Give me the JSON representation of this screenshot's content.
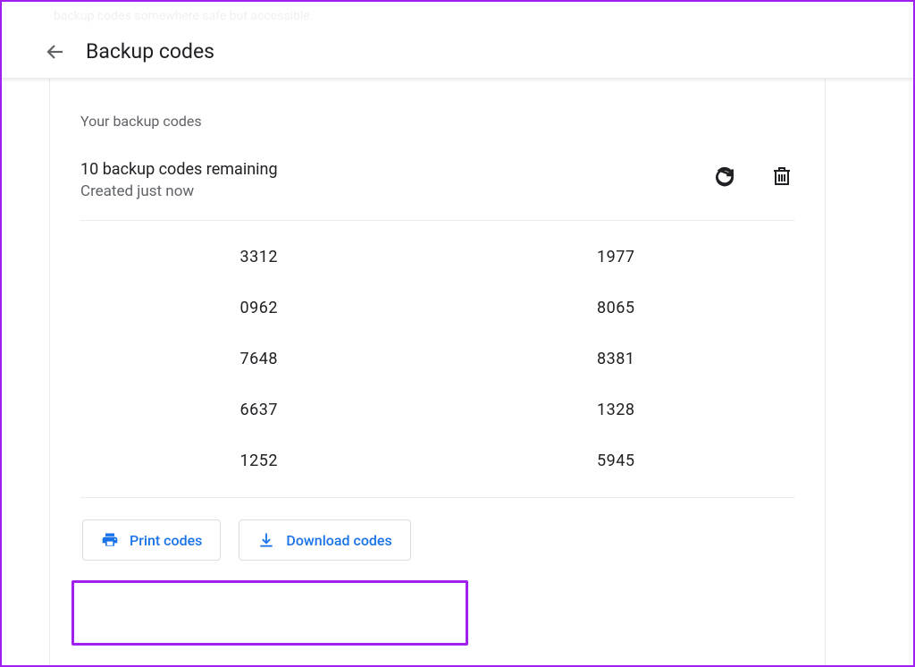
{
  "header": {
    "title": "Backup codes"
  },
  "section": {
    "label": "Your backup codes",
    "remaining": "10 backup codes remaining",
    "created": "Created just now"
  },
  "codes": {
    "col1": [
      "3312",
      "0962",
      "7648",
      "6637",
      "1252"
    ],
    "col2": [
      "1977",
      "8065",
      "8381",
      "1328",
      "5945"
    ]
  },
  "buttons": {
    "print": "Print codes",
    "download": "Download codes"
  },
  "faded": "backup codes somewhere safe but accessible."
}
